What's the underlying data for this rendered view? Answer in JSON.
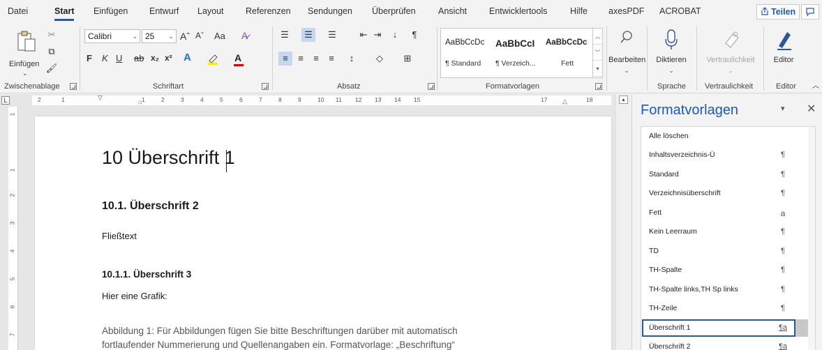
{
  "tabs": {
    "datei": "Datei",
    "start": "Start",
    "einfuegen": "Einfügen",
    "entwurf": "Entwurf",
    "layout": "Layout",
    "referenzen": "Referenzen",
    "sendungen": "Sendungen",
    "ueberpruefen": "Überprüfen",
    "ansicht": "Ansicht",
    "entwicklertools": "Entwicklertools",
    "hilfe": "Hilfe",
    "axespdf": "axesPDF",
    "acrobat": "ACROBAT",
    "teilen": "Teilen"
  },
  "ribbon": {
    "clipboard": {
      "paste_label": "Einfügen",
      "group_label": "Zwischenablage"
    },
    "font": {
      "font_name": "Calibri",
      "font_size": "25",
      "group_label": "Schriftart",
      "grow": "Aˆ",
      "shrink": "Aˇ",
      "case": "Aa",
      "bold": "F",
      "italic": "K",
      "underline": "U",
      "strike": "ab",
      "sub": "x₂",
      "sup": "x²",
      "color_a": "A"
    },
    "paragraph": {
      "group_label": "Absatz"
    },
    "styles": {
      "group_label": "Formatvorlagen",
      "items": [
        {
          "sample": "AaBbCcDc",
          "name": "¶ Standard"
        },
        {
          "sample": "AaBbCcI",
          "name": "¶ Verzeich..."
        },
        {
          "sample": "AaBbCcDc",
          "name": "Fett"
        }
      ]
    },
    "editing": {
      "label": "Bearbeiten"
    },
    "voice": {
      "label": "Diktieren",
      "group_label": "Sprache"
    },
    "sensitivity": {
      "label": "Vertraulichkeit",
      "group_label": "Vertraulichkeit"
    },
    "editor": {
      "label": "Editor",
      "group_label": "Editor"
    }
  },
  "ruler": {
    "h_numbers": [
      "2",
      "1",
      "1",
      "2",
      "3",
      "4",
      "5",
      "6",
      "7",
      "8",
      "9",
      "10",
      "11",
      "12",
      "13",
      "14",
      "15",
      "17",
      "18"
    ],
    "v_numbers": [
      "1",
      "1",
      "2",
      "3",
      "4",
      "5",
      "6",
      "7"
    ],
    "corner": "L"
  },
  "document": {
    "h1": "10  Überschrift 1",
    "h2": "10.1. Überschrift 2",
    "body1": "Fließtext",
    "h3": "10.1.1.  Überschrift 3",
    "body2": "Hier eine Grafik:",
    "caption1": "Abbildung 1: Für Abbildungen fügen Sie bitte Beschriftungen darüber mit automatisch",
    "caption2": "fortlaufender Nummerierung und Quellenangaben ein. Formatvorlage: „Beschriftung“"
  },
  "pane": {
    "title": "Formatvorlagen",
    "styles": [
      {
        "name": "Alle löschen",
        "mark": ""
      },
      {
        "name": "Inhaltsverzeichnis-Ü",
        "mark": "¶"
      },
      {
        "name": "Standard",
        "mark": "¶"
      },
      {
        "name": "Verzeichnisüberschrift",
        "mark": "¶"
      },
      {
        "name": "Fett",
        "mark": "a"
      },
      {
        "name": "Kein Leerraum",
        "mark": "¶"
      },
      {
        "name": "TD",
        "mark": "¶"
      },
      {
        "name": "TH-Spalte",
        "mark": "¶"
      },
      {
        "name": "TH-Spalte links,TH Sp links",
        "mark": "¶"
      },
      {
        "name": "TH-Zeile",
        "mark": "¶"
      },
      {
        "name": "Überschrift 1",
        "mark": "¶a",
        "selected": true
      },
      {
        "name": "Überschrift 2",
        "mark": "¶a"
      }
    ]
  },
  "colors": {
    "accent": "#185abd",
    "selection_border": "#2b579a",
    "font_color_red": "#e00000",
    "highlight_yellow": "#ffeb00"
  }
}
